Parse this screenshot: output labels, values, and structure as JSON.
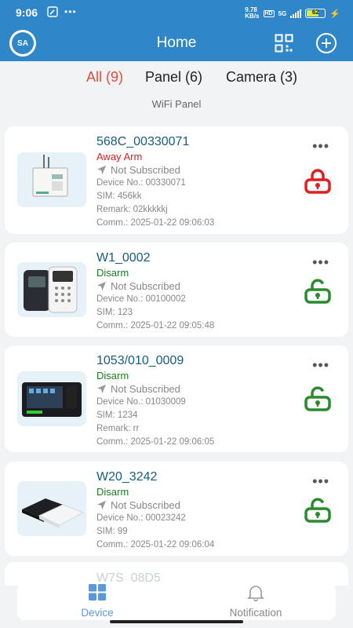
{
  "status_bar": {
    "time": "9:06",
    "net_speed_top": "9.78",
    "net_speed_bottom": "KB/s",
    "hd": "HD",
    "network": "5G",
    "battery": "62"
  },
  "app_bar": {
    "logo_text": "SA",
    "title": "Home",
    "accent": "#2f86c9"
  },
  "tabs": [
    {
      "label": "All (9)",
      "active": true
    },
    {
      "label": "Panel (6)",
      "active": false
    },
    {
      "label": "Camera (3)",
      "active": false
    }
  ],
  "section_title": "WiFi Panel",
  "devices": [
    {
      "name": "568C_00330071",
      "state": "Away Arm",
      "state_color": "red",
      "subscription": "Not Subscribed",
      "lines": [
        "Device No.: 00330071",
        "SIM: 456kk",
        "Remark: 02kkkkkj",
        "Comm.: 2025-01-22 09:06:03"
      ],
      "lock_icon": "lock-closed-icon",
      "lock_color": "#e02020"
    },
    {
      "name": "W1_0002",
      "state": "Disarm",
      "state_color": "green",
      "subscription": "Not Subscribed",
      "lines": [
        "Device No.: 00100002",
        "SIM: 123",
        "Comm.: 2025-01-22 09:05:48"
      ],
      "lock_icon": "lock-open-icon",
      "lock_color": "#2a8a2e"
    },
    {
      "name": "1053/010_0009",
      "state": "Disarm",
      "state_color": "green",
      "subscription": "Not Subscribed",
      "lines": [
        "Device No.: 01030009",
        "SIM: 1234",
        "Remark: rr",
        "Comm.: 2025-01-22 09:06:05"
      ],
      "lock_icon": "lock-open-icon",
      "lock_color": "#2a8a2e"
    },
    {
      "name": "W20_3242",
      "state": "Disarm",
      "state_color": "green",
      "subscription": "Not Subscribed",
      "lines": [
        "Device No.: 00023242",
        "SIM: 99",
        "Comm.: 2025-01-22 09:06:04"
      ],
      "lock_icon": "lock-open-icon",
      "lock_color": "#2a8a2e"
    },
    {
      "name": "W7S_08D5"
    }
  ],
  "more_label": "•••",
  "bottom_nav": [
    {
      "label": "Device",
      "icon": "grid-icon",
      "active": true,
      "color": "#5b9ad9"
    },
    {
      "label": "Notification",
      "icon": "bell-icon",
      "active": false,
      "color": "#888888"
    }
  ]
}
